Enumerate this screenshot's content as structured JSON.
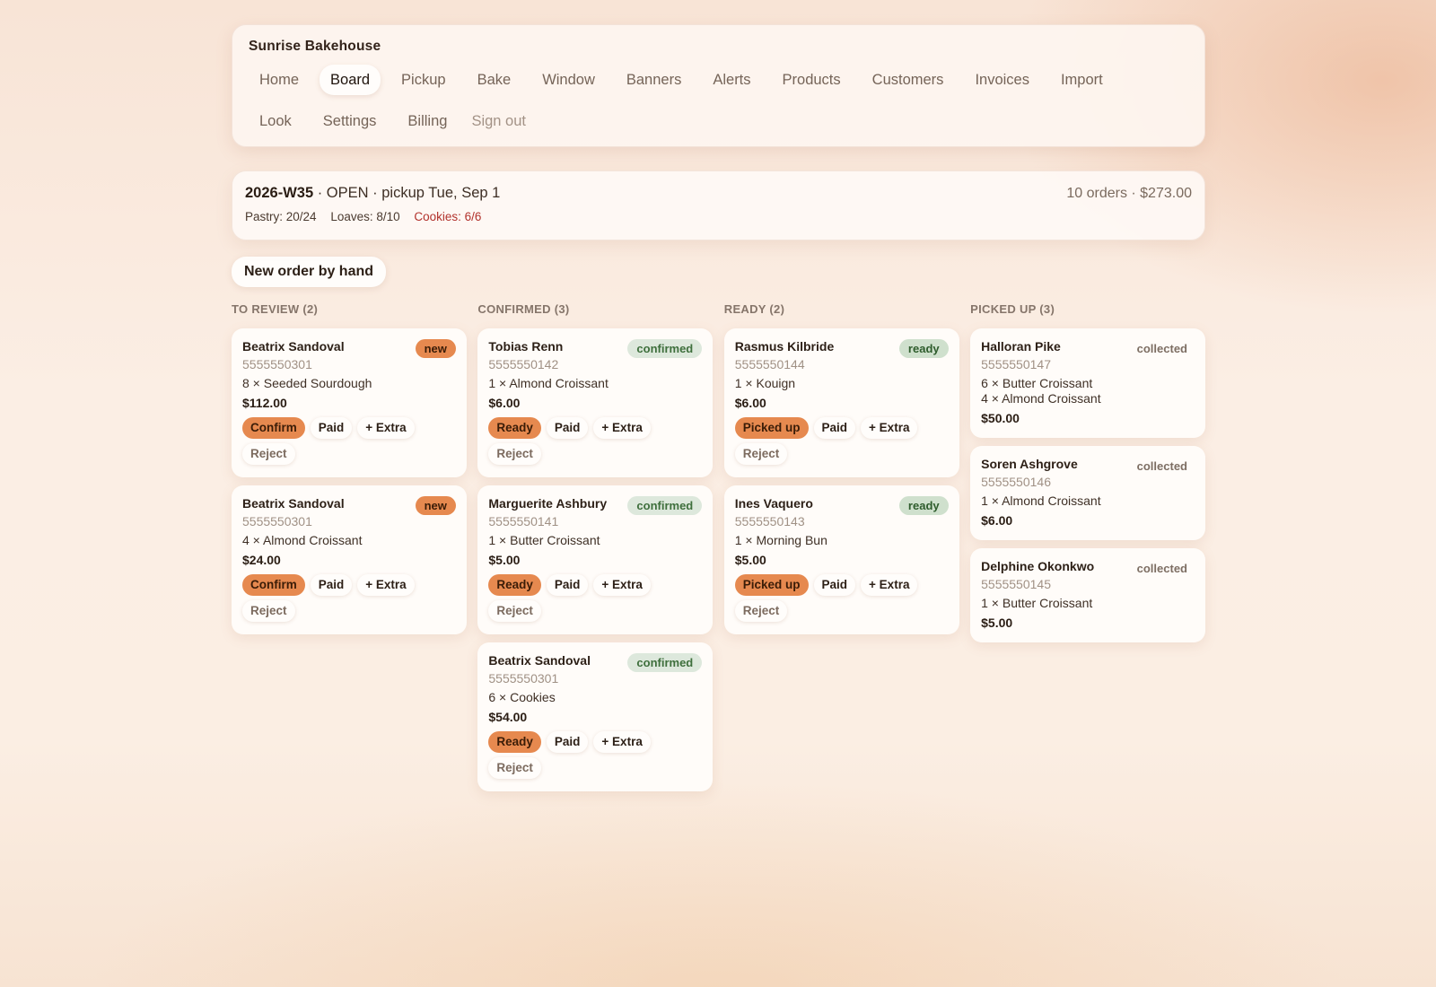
{
  "app": {
    "brand": "Sunrise Bakehouse"
  },
  "nav": {
    "items": [
      "Home",
      "Board",
      "Pickup",
      "Bake",
      "Window",
      "Banners",
      "Alerts",
      "Products",
      "Customers",
      "Invoices",
      "Import",
      "Look",
      "Settings",
      "Billing"
    ],
    "active": "Board",
    "signout": "Sign out"
  },
  "summary": {
    "week": "2026-W35",
    "status": " · OPEN · pickup Tue, Sep 1",
    "totals": "10 orders · $273.00",
    "pastry": "Pastry: 20/24",
    "loaves": "Loaves: 8/10",
    "cookies": "Cookies: 6/6",
    "warn_color": "#b2322c"
  },
  "new_order_label": "New order by hand",
  "labels": {
    "paid": "Paid",
    "extra": "+ Extra",
    "reject": "Reject"
  },
  "colors": {
    "accent": "#e6894f"
  },
  "columns": [
    {
      "title": "TO REVIEW (2)",
      "orders": [
        {
          "name": "Beatrix Sandoval",
          "phone": "5555550301",
          "items": [
            "8 × Seeded Sourdough"
          ],
          "total": "$112.00",
          "status": "new",
          "primary": "Confirm"
        },
        {
          "name": "Beatrix Sandoval",
          "phone": "5555550301",
          "items": [
            "4 × Almond Croissant"
          ],
          "total": "$24.00",
          "status": "new",
          "primary": "Confirm"
        }
      ]
    },
    {
      "title": "CONFIRMED (3)",
      "orders": [
        {
          "name": "Tobias Renn",
          "phone": "5555550142",
          "items": [
            "1 × Almond Croissant"
          ],
          "total": "$6.00",
          "status": "confirmed",
          "primary": "Ready"
        },
        {
          "name": "Marguerite Ashbury",
          "phone": "5555550141",
          "items": [
            "1 × Butter Croissant"
          ],
          "total": "$5.00",
          "status": "confirmed",
          "primary": "Ready"
        },
        {
          "name": "Beatrix Sandoval",
          "phone": "5555550301",
          "items": [
            "6 × Cookies"
          ],
          "total": "$54.00",
          "status": "confirmed",
          "primary": "Ready"
        }
      ]
    },
    {
      "title": "READY (2)",
      "orders": [
        {
          "name": "Rasmus Kilbride",
          "phone": "5555550144",
          "items": [
            "1 × Kouign"
          ],
          "total": "$6.00",
          "status": "ready",
          "primary": "Picked up"
        },
        {
          "name": "Ines Vaquero",
          "phone": "5555550143",
          "items": [
            "1 × Morning Bun"
          ],
          "total": "$5.00",
          "status": "ready",
          "primary": "Picked up"
        }
      ]
    },
    {
      "title": "PICKED UP (3)",
      "orders": [
        {
          "name": "Halloran Pike",
          "phone": "5555550147",
          "items": [
            "6 × Butter Croissant",
            "4 × Almond Croissant"
          ],
          "total": "$50.00",
          "status": "collected",
          "primary": null
        },
        {
          "name": "Soren Ashgrove",
          "phone": "5555550146",
          "items": [
            "1 × Almond Croissant"
          ],
          "total": "$6.00",
          "status": "collected",
          "primary": null
        },
        {
          "name": "Delphine Okonkwo",
          "phone": "5555550145",
          "items": [
            "1 × Butter Croissant"
          ],
          "total": "$5.00",
          "status": "collected",
          "primary": null
        }
      ]
    }
  ]
}
